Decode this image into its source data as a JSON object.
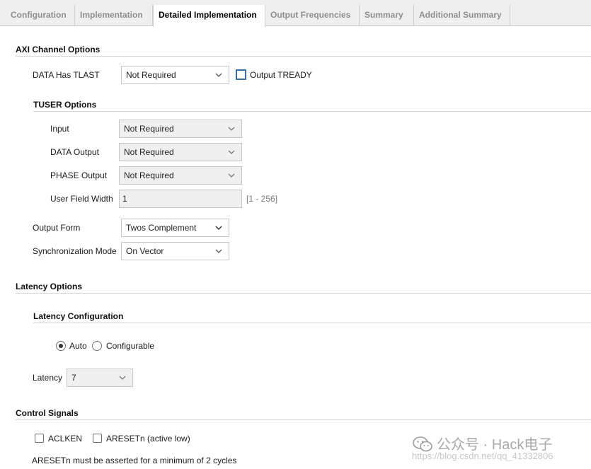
{
  "tabs": [
    {
      "label": "Configuration"
    },
    {
      "label": "Implementation"
    },
    {
      "label": "Detailed Implementation"
    },
    {
      "label": "Output Frequencies"
    },
    {
      "label": "Summary"
    },
    {
      "label": "Additional Summary"
    }
  ],
  "axi": {
    "title": "AXI Channel Options",
    "tlast_label": "DATA Has TLAST",
    "tlast_value": "Not Required",
    "tready_label": "Output TREADY",
    "tuser": {
      "title": "TUSER Options",
      "input_label": "Input",
      "input_value": "Not Required",
      "data_output_label": "DATA Output",
      "data_output_value": "Not Required",
      "phase_output_label": "PHASE Output",
      "phase_output_value": "Not Required",
      "user_field_width_label": "User Field Width",
      "user_field_width_value": "1",
      "user_field_width_range": "[1 - 256]"
    },
    "output_form_label": "Output Form",
    "output_form_value": "Twos Complement",
    "sync_mode_label": "Synchronization Mode",
    "sync_mode_value": "On Vector"
  },
  "latency": {
    "title": "Latency Options",
    "config_title": "Latency Configuration",
    "auto_label": "Auto",
    "configurable_label": "Configurable",
    "latency_label": "Latency",
    "latency_value": "7"
  },
  "control": {
    "title": "Control Signals",
    "aclken_label": "ACLKEN",
    "aresetn_label": "ARESETn (active low)",
    "note": "ARESETn must be asserted for a minimum of 2 cycles"
  },
  "watermark": {
    "text": "公众号 · Hack电子",
    "url": "https://blog.csdn.net/qq_41332806"
  }
}
